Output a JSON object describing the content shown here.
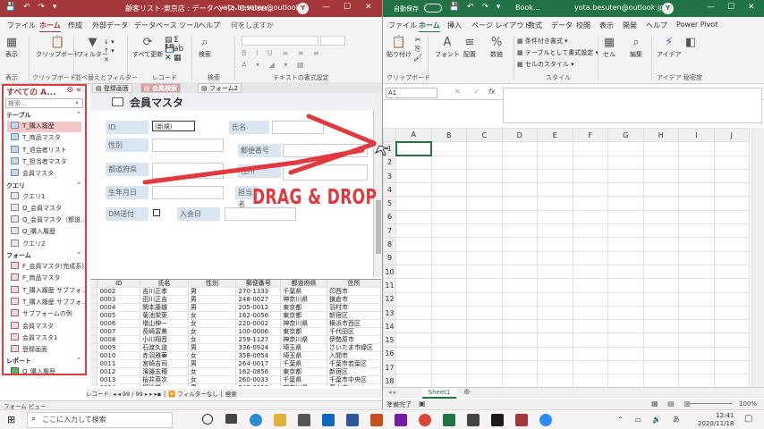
{
  "access": {
    "title": "顧客リスト-東京店 : データベース- C:¥User...",
    "user": "yota.besuten@outlook.jp",
    "avatar": "Y",
    "tabs": [
      "ファイル",
      "ホーム",
      "作成",
      "外部データ",
      "データベース ツール",
      "ヘルプ",
      "何をしますか"
    ],
    "ribbon": {
      "view": "表示",
      "clipboard": "クリップボード",
      "filter": "フィルター",
      "all_update": "すべて更新",
      "record": "レコード",
      "find": "検索",
      "group_view": "表示",
      "group_clip": "クリップボード",
      "group_sort": "並べ替えとフィルター",
      "group_rec": "レコード",
      "group_find": "検索",
      "group_text": "テキストの書式設定"
    },
    "nav": {
      "header": "すべての A...",
      "search_placeholder": "検索...",
      "sections": [
        {
          "name": "テーブル",
          "items": [
            "T_購入履歴",
            "T_商品マスタ",
            "T_退会者リスト",
            "T_担当者マスタ",
            "会員マスタ"
          ]
        },
        {
          "name": "クエリ",
          "items": [
            "クエリ1",
            "Q_会員マスタ",
            "Q_会員マスタ（都道...",
            "Q_購入履歴",
            "クエリ2"
          ]
        },
        {
          "name": "フォーム",
          "items": [
            "F_会員マスタ(完成系)",
            "F_商品マスタ",
            "T_購入履歴 サブフォ...",
            "T_購入履歴 サブフォ...",
            "サブフォームの例",
            "会員マスタ",
            "会員マスタ1",
            "登録画面"
          ]
        },
        {
          "name": "レポート",
          "items": [
            "Q_購入履歴"
          ]
        }
      ]
    },
    "doc_tabs": [
      "登録画面",
      "会員検索",
      "フォーム2"
    ],
    "form": {
      "title": "会員マスタ",
      "labels": {
        "id": "ID",
        "name": "氏名",
        "gender": "性別",
        "pref": "都道府県",
        "addr": "住所",
        "birth": "生年月日",
        "staff": "担当者",
        "dm": "DM送付",
        "join": "入会日",
        "postal": "郵便番号"
      },
      "id_value": "(新規)"
    },
    "datasheet": {
      "headers": [
        "ID",
        "氏名",
        "性別",
        "郵便番号",
        "都道府県",
        "住所"
      ],
      "rows": [
        [
          "0002",
          "吉川正孝",
          "男",
          "270-1333",
          "千葉県",
          "印西市"
        ],
        [
          "0003",
          "田川正吉",
          "男",
          "248-0027",
          "神奈川県",
          "鎌倉市"
        ],
        [
          "0004",
          "関本藤雄",
          "男",
          "205-0012",
          "東京都",
          "羽村市"
        ],
        [
          "0005",
          "菊池栄萊",
          "女",
          "162-0056",
          "東京都",
          "新宿区"
        ],
        [
          "0006",
          "増山伸一",
          "女",
          "220-0002",
          "神奈川県",
          "横浜市西区"
        ],
        [
          "0007",
          "長崎富美",
          "女",
          "100-0006",
          "東京都",
          "千代田区"
        ],
        [
          "0008",
          "小川翔音",
          "女",
          "259-1127",
          "神奈川県",
          "伊勢原市"
        ],
        [
          "0009",
          "石渡久道",
          "男",
          "336-0924",
          "埼玉県",
          "さいたま市緑区"
        ],
        [
          "0010",
          "赤羽雅華",
          "女",
          "358-0054",
          "埼玉県",
          "入間市"
        ],
        [
          "0011",
          "宮崎吉司",
          "男",
          "264-0017",
          "千葉県",
          "千葉市若葉区"
        ],
        [
          "0012",
          "濱邉志穂",
          "女",
          "162-0856",
          "東京都",
          "新宿区"
        ],
        [
          "0013",
          "桜井英次",
          "女",
          "260-0033",
          "千葉県",
          "千葉市中央区"
        ],
        [
          "0014",
          "福地兼",
          "男",
          "243-0816",
          "神奈川県",
          "厚木市"
        ]
      ]
    },
    "record_nav": "レコード: ◂ ◂ 99 / 99 ▸ ▸ ▸▪ │ 🔽 フィルターなし │ 検索",
    "status": "フォーム ビュー"
  },
  "excel": {
    "autosave": "自動保存",
    "title": "Book...",
    "user": "yota.besuten@outlook.jp",
    "avatar": "Y",
    "tabs": [
      "ファイル",
      "ホーム",
      "挿入",
      "ページ レイアウト",
      "数式",
      "データ",
      "校閲",
      "表示",
      "開発",
      "ヘルプ",
      "Power Pivot"
    ],
    "ribbon": {
      "paste": "貼り付け",
      "font": "フォント",
      "align": "配置",
      "number": "数値",
      "cond": "条件付き書式 ▾",
      "table": "テーブルとして書式設定 ▾",
      "cellstyle": "セルのスタイル ▾",
      "cell": "セル",
      "edit": "編集",
      "idea": "アイデア",
      "group_clip": "クリップボード",
      "group_style": "スタイル",
      "group_idea": "アイデア",
      "group_sens": "秘密度"
    },
    "namebox": "A1",
    "fx": "fx",
    "columns": [
      "A",
      "B",
      "C",
      "D",
      "E",
      "F",
      "G",
      "H",
      "I",
      "J"
    ],
    "rows": [
      "1",
      "2",
      "3",
      "4",
      "5",
      "6",
      "7",
      "8",
      "9",
      "10",
      "11",
      "12",
      "13",
      "14",
      "15",
      "16",
      "17",
      "18"
    ],
    "sheet": "Sheet1",
    "status": "準備完了",
    "zoom": "100%"
  },
  "taskbar": {
    "search": "ここに入力して検索",
    "time": "12:41",
    "date": "2020/11/18"
  },
  "overlay": {
    "text": "DRAG & DROP",
    "color": "#e0393f"
  }
}
